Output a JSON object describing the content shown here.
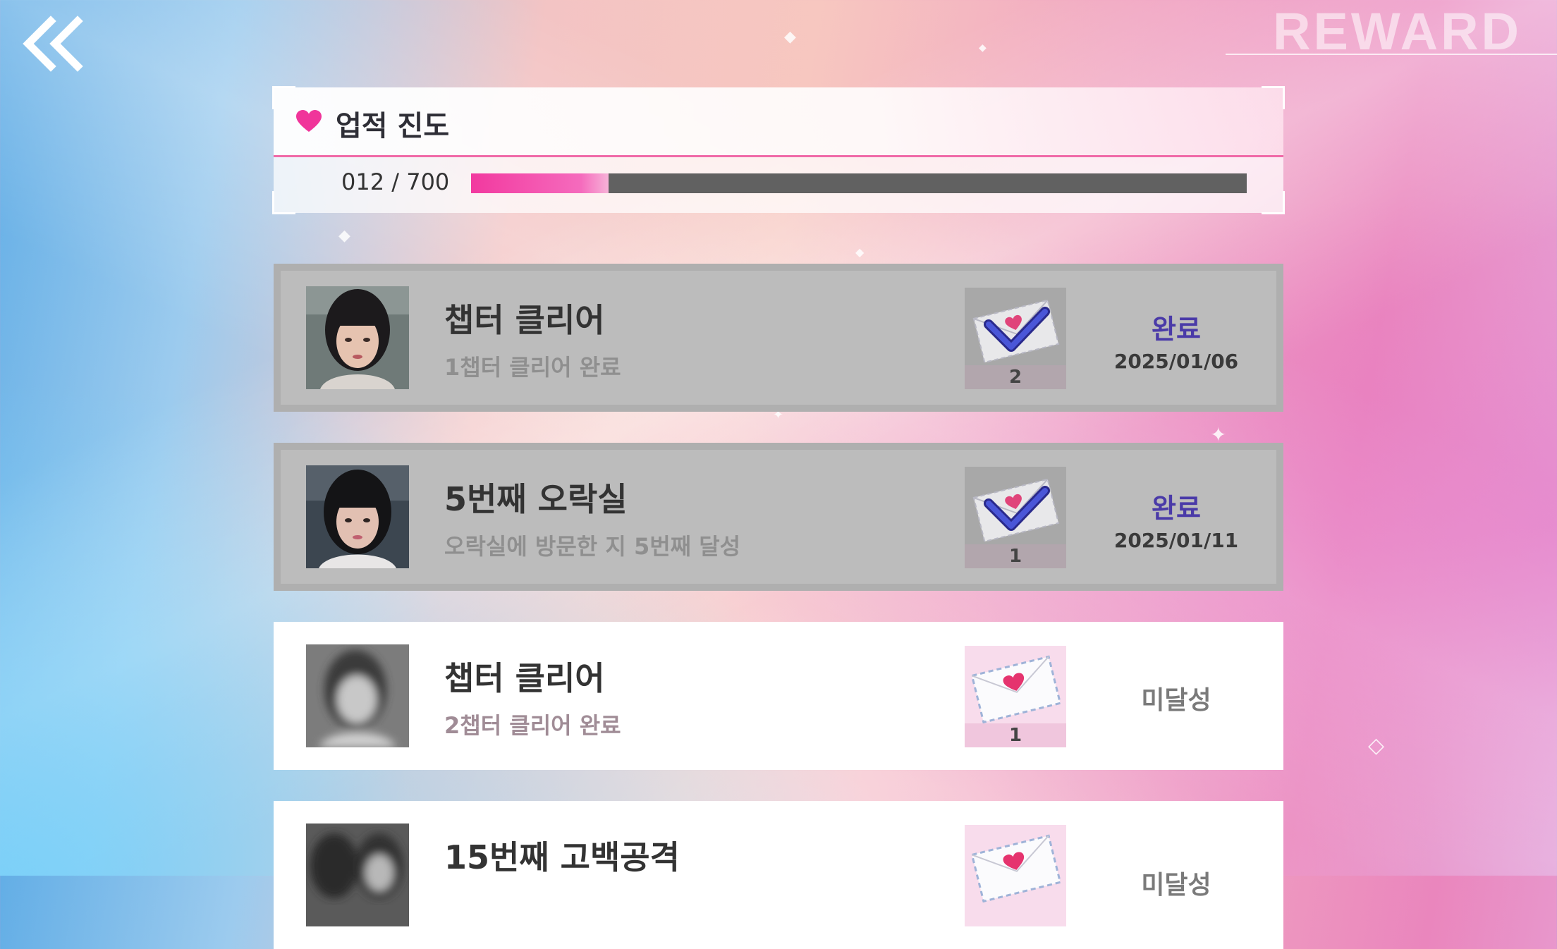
{
  "header": {
    "screen_title": "REWARD"
  },
  "progress": {
    "title": "업적 진도",
    "count_text": "012 / 700",
    "current": 12,
    "total": 700,
    "fill_fraction": 0.177
  },
  "achievements": [
    {
      "title": "챕터 클리어",
      "description": "1챕터 클리어 완료",
      "reward_count": "2",
      "status": "완료",
      "date": "2025/01/06",
      "completed": true
    },
    {
      "title": "5번째 오락실",
      "description": "오락실에 방문한 지 5번째 달성",
      "reward_count": "1",
      "status": "완료",
      "date": "2025/01/11",
      "completed": true
    },
    {
      "title": "챕터 클리어",
      "description": "2챕터 클리어 완료",
      "reward_count": "1",
      "status": "미달성",
      "completed": false
    },
    {
      "title": "15번째 고백공격",
      "status": "미달성",
      "completed": false
    }
  ],
  "colors": {
    "accent_pink": "#f2399f",
    "done_status": "#4a3aa8",
    "progress_track": "#616161"
  },
  "icons": {
    "back": "double-chevron-left-icon",
    "heart": "heart-icon",
    "reward_done": "checked-letter-icon",
    "reward_todo": "love-letter-icon"
  }
}
